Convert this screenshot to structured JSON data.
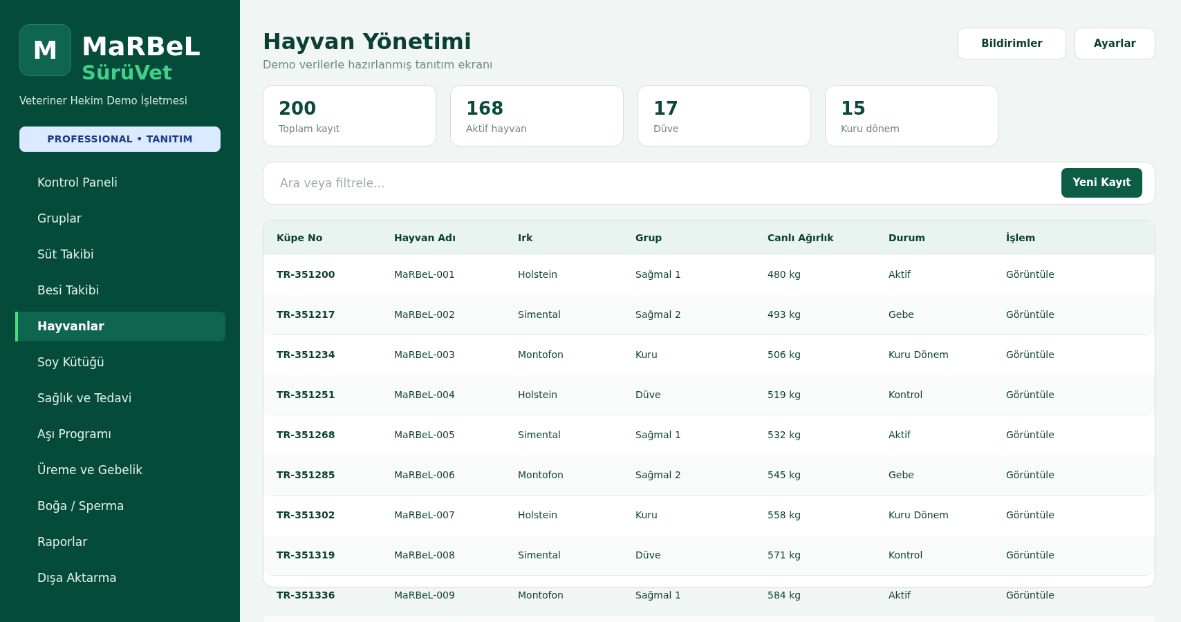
{
  "sidebar": {
    "logo_letter": "M",
    "brand": "MaRBeL",
    "product": "SürüVet",
    "organization": "Veteriner Hekim Demo İşletmesi",
    "plan_badge": "PROFESSIONAL • TANITIM",
    "items": [
      {
        "label": "Kontrol Paneli",
        "selected": false
      },
      {
        "label": "Gruplar",
        "selected": false
      },
      {
        "label": "Süt Takibi",
        "selected": false
      },
      {
        "label": "Besi Takibi",
        "selected": false
      },
      {
        "label": "Hayvanlar",
        "selected": true
      },
      {
        "label": "Soy Kütüğü",
        "selected": false
      },
      {
        "label": "Sağlık ve Tedavi",
        "selected": false
      },
      {
        "label": "Aşı Programı",
        "selected": false
      },
      {
        "label": "Üreme ve Gebelik",
        "selected": false
      },
      {
        "label": "Boğa / Sperma",
        "selected": false
      },
      {
        "label": "Raporlar",
        "selected": false
      },
      {
        "label": "Dışa Aktarma",
        "selected": false
      }
    ]
  },
  "header": {
    "title": "Hayvan Yönetimi",
    "subtitle": "Demo verilerle hazırlanmış tanıtım ekranı",
    "buttons": [
      "Bildirimler",
      "Ayarlar"
    ]
  },
  "stats": [
    {
      "value": "200",
      "label": "Toplam kayıt"
    },
    {
      "value": "168",
      "label": "Aktif hayvan"
    },
    {
      "value": "17",
      "label": "Düve"
    },
    {
      "value": "15",
      "label": "Kuru dönem"
    }
  ],
  "search": {
    "placeholder": "Ara veya filtrele...",
    "button": "Yeni Kayıt"
  },
  "table": {
    "columns": [
      "Küpe No",
      "Hayvan Adı",
      "Irk",
      "Grup",
      "Canlı Ağırlık",
      "Durum",
      "İşlem"
    ],
    "rows": [
      [
        "TR-351200",
        "MaRBeL-001",
        "Holstein",
        "Sağmal 1",
        "480 kg",
        "Aktif",
        "Görüntüle"
      ],
      [
        "TR-351217",
        "MaRBeL-002",
        "Simental",
        "Sağmal 2",
        "493 kg",
        "Gebe",
        "Görüntüle"
      ],
      [
        "TR-351234",
        "MaRBeL-003",
        "Montofon",
        "Kuru",
        "506 kg",
        "Kuru Dönem",
        "Görüntüle"
      ],
      [
        "TR-351251",
        "MaRBeL-004",
        "Holstein",
        "Düve",
        "519 kg",
        "Kontrol",
        "Görüntüle"
      ],
      [
        "TR-351268",
        "MaRBeL-005",
        "Simental",
        "Sağmal 1",
        "532 kg",
        "Aktif",
        "Görüntüle"
      ],
      [
        "TR-351285",
        "MaRBeL-006",
        "Montofon",
        "Sağmal 2",
        "545 kg",
        "Gebe",
        "Görüntüle"
      ],
      [
        "TR-351302",
        "MaRBeL-007",
        "Holstein",
        "Kuru",
        "558 kg",
        "Kuru Dönem",
        "Görüntüle"
      ],
      [
        "TR-351319",
        "MaRBeL-008",
        "Simental",
        "Düve",
        "571 kg",
        "Kontrol",
        "Görüntüle"
      ],
      [
        "TR-351336",
        "MaRBeL-009",
        "Montofon",
        "Sağmal 1",
        "584 kg",
        "Aktif",
        "Görüntüle"
      ]
    ]
  }
}
